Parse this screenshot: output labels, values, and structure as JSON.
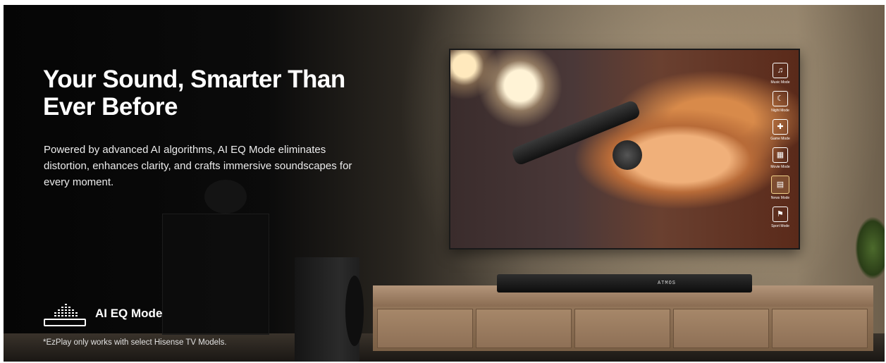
{
  "banner": {
    "heading": "Your Sound, Smarter Than Ever Before",
    "body": "Powered by advanced AI algorithms, AI EQ Mode eliminates distortion, enhances clarity, and crafts immersive soundscapes for every moment.",
    "feature": {
      "icon": "equalizer-icon",
      "label": "AI EQ Mode"
    },
    "footnote": "*EzPlay only works with select Hisense TV Models."
  },
  "tv_menu": [
    {
      "icon": "music-note-icon",
      "label": "Music Mode"
    },
    {
      "icon": "moon-icon",
      "label": "Night Mode"
    },
    {
      "icon": "gamepad-icon",
      "label": "Game Mode"
    },
    {
      "icon": "clapperboard-icon",
      "label": "Movie Mode"
    },
    {
      "icon": "news-icon",
      "label": "News Mode",
      "active": true
    },
    {
      "icon": "runner-icon",
      "label": "Sport Mode"
    }
  ],
  "soundbar": {
    "label": "ATMOS"
  },
  "colors": {
    "text": "#ffffff",
    "background_dark": "#050505",
    "active_highlight": "#f1d28a"
  }
}
